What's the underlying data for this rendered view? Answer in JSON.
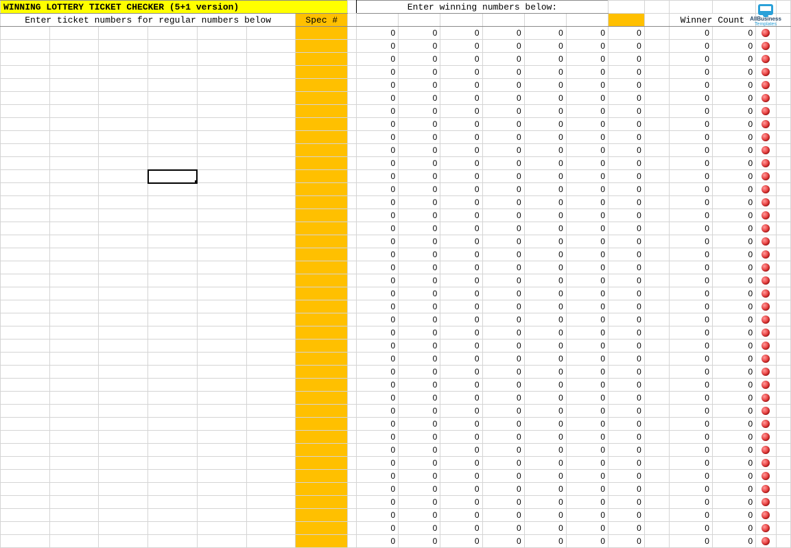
{
  "title": "WINNING LOTTERY TICKET CHECKER (5+1 version)",
  "ticket_prompt": "Enter ticket numbers for regular numbers below",
  "spec_header": "Spec #",
  "winning_prompt": "Enter winning numbers below:",
  "winner_count_label": "Winner Count",
  "logo": {
    "line1": "AllBusiness",
    "line2": "Templates"
  },
  "row_count": 40,
  "default_num": "0",
  "selected": {
    "row": 11,
    "col": 3
  }
}
